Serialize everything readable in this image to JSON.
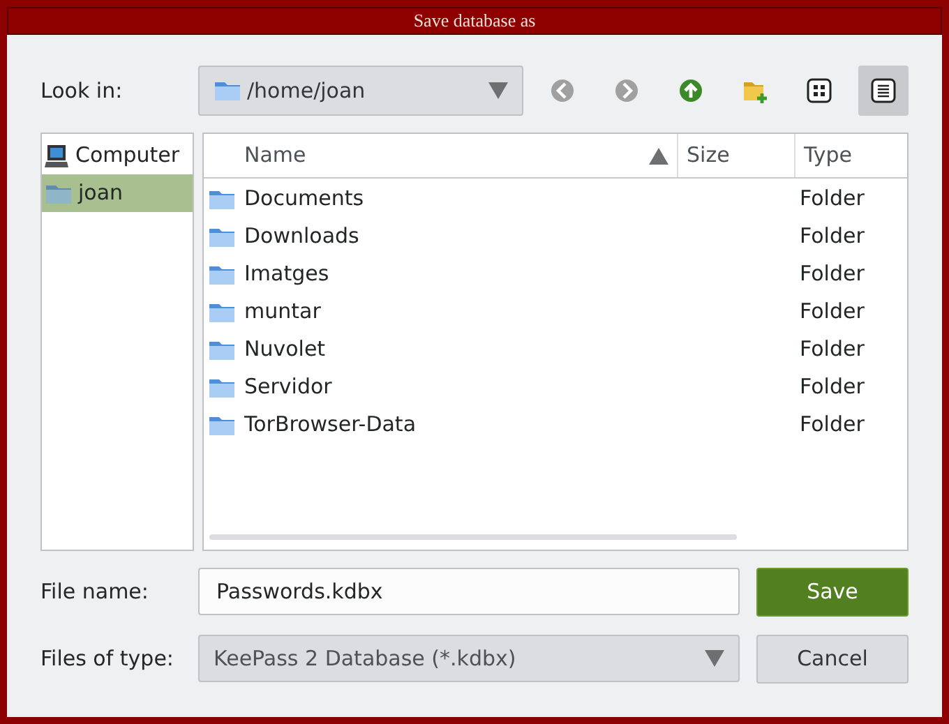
{
  "window": {
    "title": "Save database as"
  },
  "look_in": {
    "label": "Look in:",
    "value": "/home/joan"
  },
  "toolbar": [
    {
      "kind": "back",
      "disabled": true,
      "selected": false
    },
    {
      "kind": "forward",
      "disabled": true,
      "selected": false
    },
    {
      "kind": "up",
      "disabled": false,
      "selected": false
    },
    {
      "kind": "new_folder",
      "disabled": false,
      "selected": false
    },
    {
      "kind": "icon_view",
      "disabled": false,
      "selected": false
    },
    {
      "kind": "detail_view",
      "disabled": false,
      "selected": true
    }
  ],
  "sidebar": {
    "items": [
      {
        "label": "Computer",
        "kind": "computer",
        "selected": false
      },
      {
        "label": "joan",
        "kind": "folder",
        "selected": true
      }
    ]
  },
  "table": {
    "columns": [
      {
        "label": "Name",
        "sorted": true
      },
      {
        "label": "Size",
        "sorted": false
      },
      {
        "label": "Type",
        "sorted": false
      }
    ],
    "rows": [
      {
        "name": "Documents",
        "type": "Folder"
      },
      {
        "name": "Downloads",
        "type": "Folder"
      },
      {
        "name": "Imatges",
        "type": "Folder"
      },
      {
        "name": "muntar",
        "type": "Folder"
      },
      {
        "name": "Nuvolet",
        "type": "Folder"
      },
      {
        "name": "Servidor",
        "type": "Folder"
      },
      {
        "name": "TorBrowser-Data",
        "type": "Folder"
      }
    ]
  },
  "file_name": {
    "label": "File name:",
    "value": "Passwords.kdbx"
  },
  "file_type": {
    "label": "Files of type:",
    "value": "KeePass 2 Database (*.kdbx)"
  },
  "buttons": [
    {
      "label": "Save",
      "kind": "primary"
    },
    {
      "label": "Cancel",
      "kind": "secondary"
    }
  ]
}
